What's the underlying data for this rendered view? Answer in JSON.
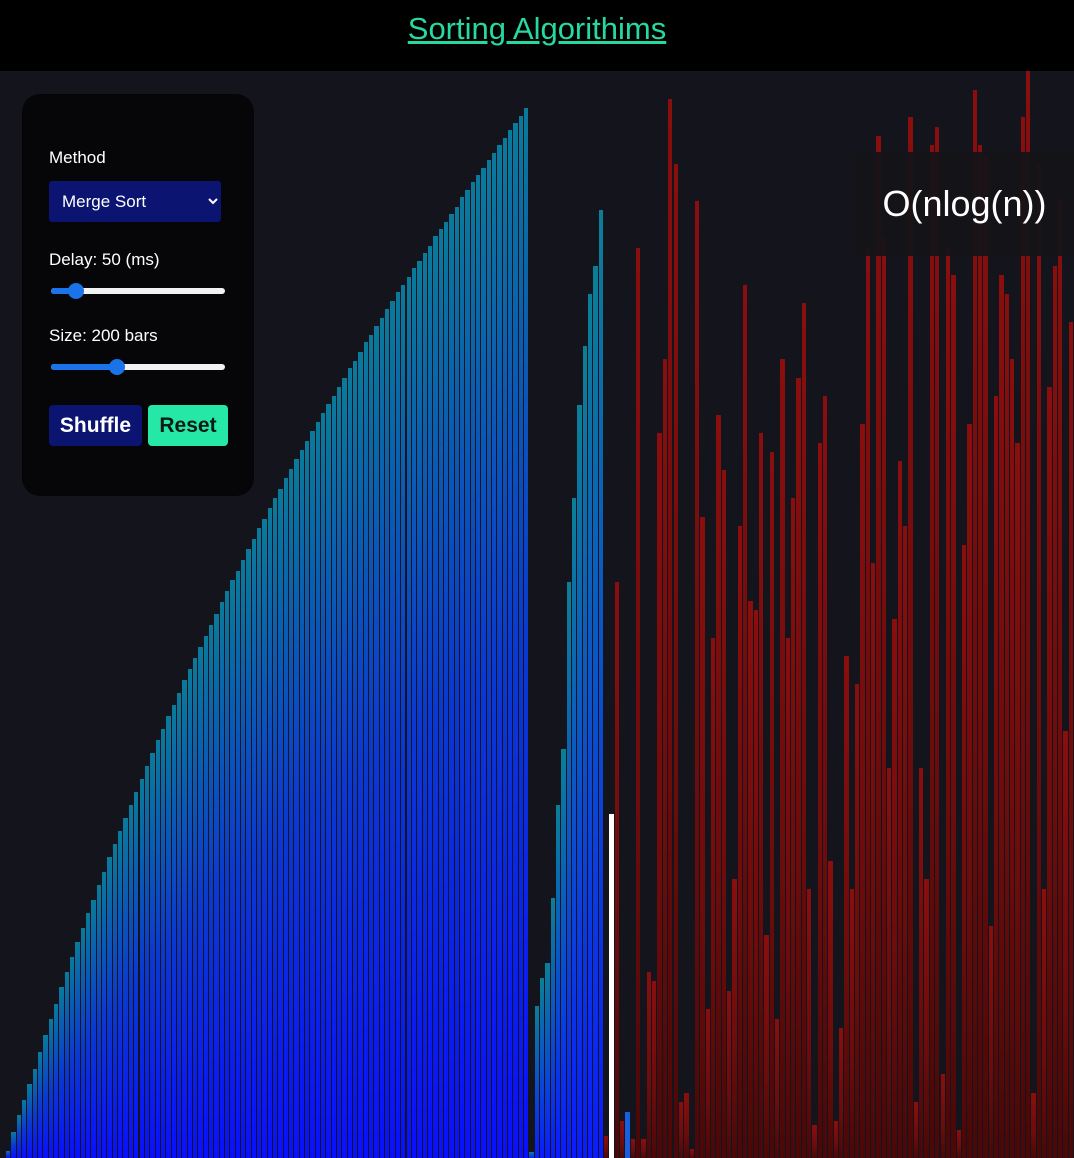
{
  "header": {
    "title": "Sorting Algorithims"
  },
  "complexity": {
    "label": "O(nlog(n))"
  },
  "controls": {
    "method_label": "Method",
    "method_selected": "Merge Sort",
    "delay_label": "Delay: 50 (ms)",
    "delay_fraction": 0.12,
    "size_label": "Size: 200 bars",
    "size_fraction": 0.37,
    "shuffle_label": "Shuffle",
    "reset_label": "Reset"
  },
  "colors": {
    "accent": "#26d9a0",
    "button_dark": "#0b1470",
    "sorted_bar": "#0a10ff",
    "unsorted_bar": "#8a0e0e",
    "active_bar": "#ffffff"
  },
  "visualizer": {
    "bar_count": 200,
    "sorted_end": 98,
    "partial_end": 112,
    "compare_index": 116,
    "active_index": 113,
    "values": [
      4,
      14,
      23,
      31,
      40,
      48,
      57,
      66,
      75,
      83,
      92,
      100,
      108,
      116,
      124,
      132,
      139,
      147,
      154,
      162,
      169,
      176,
      183,
      190,
      197,
      204,
      211,
      218,
      225,
      231,
      238,
      244,
      250,
      257,
      263,
      269,
      275,
      281,
      287,
      293,
      299,
      305,
      311,
      316,
      322,
      328,
      333,
      339,
      344,
      350,
      355,
      360,
      366,
      371,
      376,
      381,
      386,
      391,
      396,
      401,
      406,
      410,
      415,
      420,
      425,
      429,
      434,
      439,
      443,
      448,
      452,
      457,
      461,
      466,
      470,
      474,
      479,
      483,
      487,
      491,
      496,
      500,
      504,
      508,
      512,
      517,
      521,
      525,
      529,
      533,
      537,
      541,
      545,
      549,
      553,
      557,
      561,
      565,
      3,
      82,
      97,
      105,
      140,
      190,
      220,
      310,
      355,
      405,
      437,
      465,
      480,
      510,
      12,
      185,
      310,
      20,
      25,
      10,
      490,
      10,
      100,
      95,
      390,
      430,
      570,
      535,
      30,
      35,
      5,
      515,
      345,
      80,
      280,
      400,
      370,
      90,
      150,
      340,
      470,
      300,
      295,
      390,
      120,
      380,
      75,
      430,
      280,
      355,
      420,
      460,
      145,
      18,
      385,
      410,
      160,
      20,
      70,
      270,
      145,
      255,
      395,
      490,
      320,
      550,
      495,
      210,
      290,
      375,
      340,
      560,
      30,
      210,
      150,
      545,
      555,
      45,
      490,
      475,
      15,
      330,
      395,
      575,
      545,
      540,
      125,
      410,
      475,
      465,
      430,
      385,
      560,
      585,
      35,
      535,
      145,
      415,
      480,
      515,
      230,
      450
    ]
  }
}
